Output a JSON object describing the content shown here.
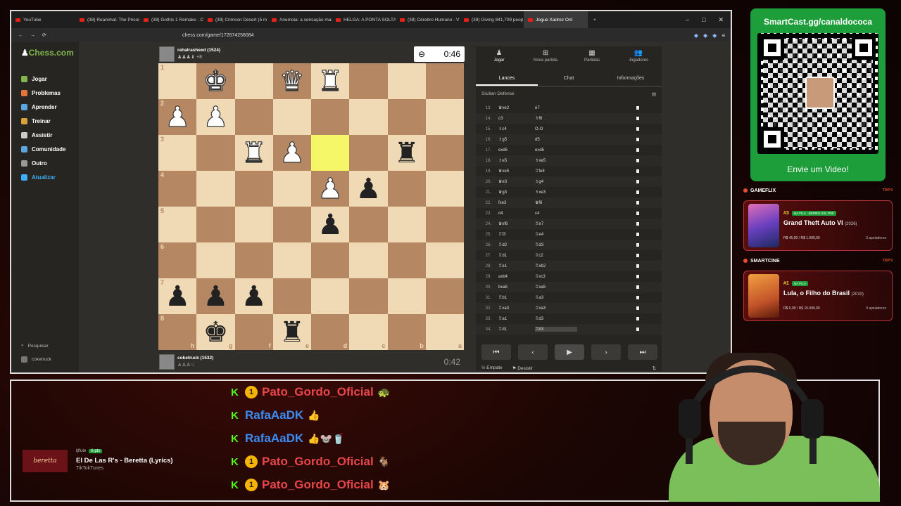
{
  "browser": {
    "tabs": [
      {
        "label": "YouTube",
        "active": false
      },
      {
        "label": "(38) Reanimal: The Prisoner",
        "active": false
      },
      {
        "label": "(38) Gothic 1 Remake - Ce",
        "active": false
      },
      {
        "label": "(39) Crimson Desert (5 m",
        "active": false
      },
      {
        "label": "Anemoia: a sensação mai",
        "active": false
      },
      {
        "label": "HELGA: A PONTA SOLTA",
        "active": false
      },
      {
        "label": "(38) Cérebro Humano - V",
        "active": false
      },
      {
        "label": "(39) Giving 841,709 peop",
        "active": false
      },
      {
        "label": "Jogue Xadrez Onl",
        "active": true
      }
    ],
    "url": "chess.com/game/172674256084"
  },
  "sidebar": {
    "logo": "Chess.com",
    "items": [
      {
        "label": "Jogar",
        "color": "#81b64c"
      },
      {
        "label": "Problemas",
        "color": "#e5753a"
      },
      {
        "label": "Aprender",
        "color": "#5aa6e0"
      },
      {
        "label": "Treinar",
        "color": "#d9a23a"
      },
      {
        "label": "Assistir",
        "color": "#cccccc"
      },
      {
        "label": "Comunidade",
        "color": "#5aa6e0"
      },
      {
        "label": "Outro",
        "color": "#999999"
      },
      {
        "label": "Atualizar",
        "color": "#3db0f7"
      }
    ],
    "search": "Pesquisar",
    "user": "coketruck"
  },
  "top_player": {
    "name": "rahalrasheed (1524)",
    "captured": "♟♟♟♝ +8",
    "clock": "0:46"
  },
  "bottom_player": {
    "name": "coketruck (1532)",
    "captured": "♙♙♙♘",
    "clock": "0:42"
  },
  "board": {
    "ranks": [
      "1",
      "2",
      "3",
      "4",
      "5",
      "6",
      "7",
      "8"
    ],
    "files": [
      "h",
      "g",
      "f",
      "e",
      "d",
      "c",
      "b",
      "a"
    ],
    "rows": [
      [
        "",
        "wK",
        "",
        "wQ",
        "wR",
        "",
        "",
        ""
      ],
      [
        "wP",
        "wP",
        "",
        "",
        "",
        "",
        "",
        ""
      ],
      [
        "",
        "",
        "wR",
        "wP",
        "HL",
        "",
        "bR",
        ""
      ],
      [
        "",
        "",
        "",
        "",
        "wP",
        "bP",
        "",
        ""
      ],
      [
        "",
        "",
        "",
        "",
        "bP",
        "",
        "",
        ""
      ],
      [
        "",
        "",
        "",
        "",
        "",
        "",
        "",
        ""
      ],
      [
        "bP",
        "bP",
        "bP",
        "",
        "",
        "",
        "",
        ""
      ],
      [
        "",
        "bK",
        "",
        "bR",
        "",
        "",
        "",
        ""
      ]
    ]
  },
  "panel": {
    "tabs": [
      {
        "label": "Jogar",
        "icon": "♟"
      },
      {
        "label": "Nova partida",
        "icon": "⊞"
      },
      {
        "label": "Partidas",
        "icon": "▦"
      },
      {
        "label": "Jogadores",
        "icon": "👥"
      }
    ],
    "subtabs": [
      "Lances",
      "Chat",
      "Informações"
    ],
    "opening": "Sicilian Defense",
    "moves": [
      {
        "n": "13.",
        "w": "♛xe2",
        "b": "e7"
      },
      {
        "n": "14.",
        "w": "c3",
        "b": "♗f6"
      },
      {
        "n": "15.",
        "w": "♗c4",
        "b": "O-O"
      },
      {
        "n": "16.",
        "w": "♗g5",
        "b": "d5"
      },
      {
        "n": "17.",
        "w": "exd5",
        "b": "exd5"
      },
      {
        "n": "18.",
        "w": "♗e5",
        "b": "♗xe5"
      },
      {
        "n": "19.",
        "w": "♛xe5",
        "b": "♖fe8"
      },
      {
        "n": "20.",
        "w": "♛e3",
        "b": "♗g4"
      },
      {
        "n": "21.",
        "w": "♛g3",
        "b": "♗xe3"
      },
      {
        "n": "22.",
        "w": "fxe3",
        "b": "♛f6"
      },
      {
        "n": "23.",
        "w": "d4",
        "b": "c4"
      },
      {
        "n": "24.",
        "w": "♛xf6",
        "b": "♖e7"
      },
      {
        "n": "25.",
        "w": "♖f3",
        "b": "♖e4"
      },
      {
        "n": "26.",
        "w": "♖d2",
        "b": "♖d3"
      },
      {
        "n": "27.",
        "w": "♖d1",
        "b": "♖c2"
      },
      {
        "n": "28.",
        "w": "♖e1",
        "b": "♖xb2"
      },
      {
        "n": "29.",
        "w": "axb4",
        "b": "♖xc3"
      },
      {
        "n": "30.",
        "w": "bxa5",
        "b": "♖xa5"
      },
      {
        "n": "31.",
        "w": "♖b1",
        "b": "♖a3"
      },
      {
        "n": "32.",
        "w": "♖xa3",
        "b": "♖xa3"
      },
      {
        "n": "33.",
        "w": "♖a1",
        "b": "♖d3"
      },
      {
        "n": "34.",
        "w": "♖d1",
        "b": "♖b3"
      }
    ],
    "nav": [
      "⏮",
      "‹",
      "▶",
      "›",
      "⏭"
    ],
    "draw": "Empate",
    "resign": "Desistir"
  },
  "overlay": {
    "qr_title": "SmartCast.gg/canaldococa",
    "qr_footer": "Envie um Video!",
    "gameflix": {
      "header": "GAMEFLIX",
      "top": "TOP 5",
      "rank": "#3",
      "badge": "NA FILA · SERIES X/S, PS5",
      "title": "Grand Theft Auto VI",
      "year": "(2026)",
      "price": "R$ 45,00 / R$ 1.000,00",
      "supporters": "3 apoiadores"
    },
    "smartcine": {
      "header": "SMARTCINE",
      "top": "TOP 5",
      "rank": "#1",
      "badge": "NA FILA",
      "title": "Lula, o Filho do Brasil",
      "year": "(2010)",
      "price": "R$ 0,00 / R$ 15.000,00",
      "supporters": "0 apoiadores"
    }
  },
  "chat": [
    {
      "badge": "1",
      "user": "Pato_Gordo_Oficial",
      "color": "red",
      "emote": "🐢"
    },
    {
      "badge": "",
      "user": "RafaAaDK",
      "color": "blue",
      "emote": "👍"
    },
    {
      "badge": "",
      "user": "RafaAaDK",
      "color": "blue",
      "emote": "👍🐭🥤"
    },
    {
      "badge": "1",
      "user": "Pato_Gordo_Oficial",
      "color": "red",
      "emote": "🐐"
    },
    {
      "badge": "1",
      "user": "Pato_Gordo_Oficial",
      "color": "red",
      "emote": "🐹"
    }
  ],
  "music": {
    "cover": "beretta",
    "user": "tjflute",
    "pts": "6 pts",
    "song": "El De Las R's - Beretta (Lyrics)",
    "source": "TikTokTunes"
  }
}
